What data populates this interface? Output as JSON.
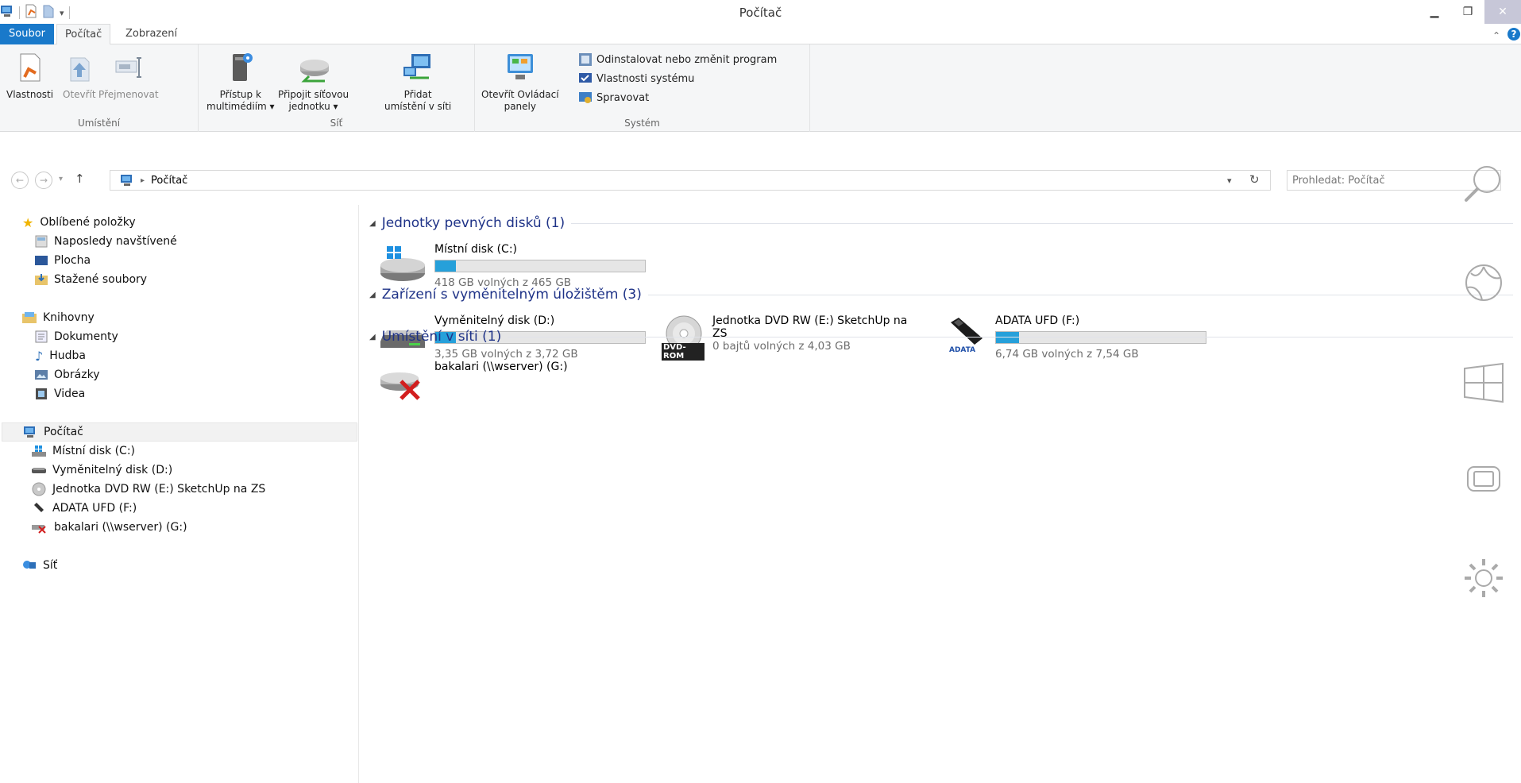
{
  "window": {
    "title": "Počítač"
  },
  "ribbon_tabs": {
    "file": "Soubor",
    "computer": "Počítač",
    "view": "Zobrazení"
  },
  "ribbon": {
    "location": {
      "label": "Umístění",
      "properties": "Vlastnosti",
      "open": "Otevřít",
      "rename": "Přejmenovat"
    },
    "network": {
      "label": "Síť",
      "media_line1": "Přístup k",
      "media_line2": "multimédiím ▾",
      "map_line1": "Připojit síťovou",
      "map_line2": "jednotku ▾",
      "add_line1": "Přidat",
      "add_line2": "umístění v síti"
    },
    "system": {
      "label": "Systém",
      "cp_line1": "Otevřít Ovládací",
      "cp_line2": "panely",
      "uninstall": "Odinstalovat nebo změnit program",
      "sysprops": "Vlastnosti systému",
      "manage": "Spravovat"
    }
  },
  "address": {
    "location": "Počítač",
    "search_placeholder": "Prohledat: Počítač"
  },
  "nav": {
    "favorites": "Oblíbené položky",
    "recent": "Naposledy navštívené",
    "desktop": "Plocha",
    "downloads": "Stažené soubory",
    "libraries": "Knihovny",
    "documents": "Dokumenty",
    "music": "Hudba",
    "pictures": "Obrázky",
    "videos": "Videa",
    "computer": "Počítač",
    "drive_c": "Místní disk (C:)",
    "drive_d": "Vyměnitelný disk (D:)",
    "drive_e": "Jednotka DVD RW (E:) SketchUp na ZS",
    "drive_f": "ADATA UFD (F:)",
    "drive_g": "bakalari (\\\\wserver) (G:)",
    "network": "Síť"
  },
  "content": {
    "hdd_section": "Jednotky pevných disků (1)",
    "removable_section": "Zařízení s vyměnitelným úložištěm (3)",
    "network_section": "Umístění v síti (1)",
    "drive_c": {
      "name": "Místní disk (C:)",
      "free": "418 GB volných z 465 GB",
      "used_fraction": 0.1
    },
    "drive_d": {
      "name": "Vyměnitelný disk (D:)",
      "free": "3,35 GB volných z 3,72 GB",
      "used_fraction": 0.1
    },
    "drive_e": {
      "name_line1": "Jednotka DVD RW (E:) SketchUp na",
      "name_line2": "ZS",
      "free": "0 bajtů volných z 4,03 GB",
      "badge": "DVD-ROM"
    },
    "drive_f": {
      "name": "ADATA UFD (F:)",
      "free": "6,74 GB volných z 7,54 GB",
      "used_fraction": 0.11,
      "brand": "ADATA"
    },
    "drive_g": {
      "name": "bakalari (\\\\wserver) (G:)"
    }
  },
  "colors": {
    "accent": "#1979ca",
    "bar_fill": "#26a0da",
    "section_heading": "#1e3287"
  }
}
